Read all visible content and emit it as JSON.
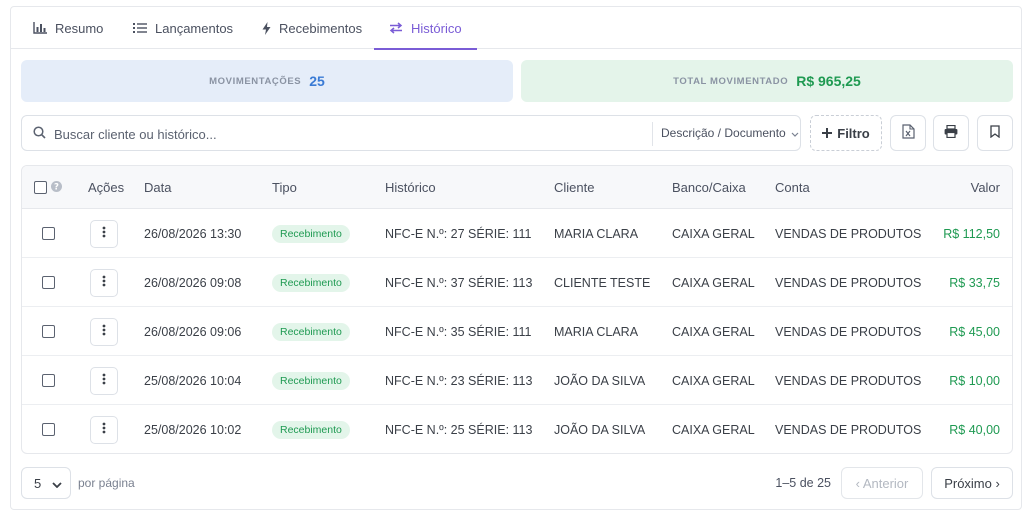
{
  "tabs": [
    {
      "label": "Resumo",
      "icon": "bar-chart-icon"
    },
    {
      "label": "Lançamentos",
      "icon": "list-icon"
    },
    {
      "label": "Recebimentos",
      "icon": "bolt-icon"
    },
    {
      "label": "Histórico",
      "icon": "swap-arrows-icon",
      "active": true
    }
  ],
  "stats": {
    "movimentacoes_label": "MOVIMENTAÇÕES",
    "movimentacoes_value": "25",
    "total_label": "TOTAL MOVIMENTADO",
    "total_value": "R$ 965,25"
  },
  "toolbar": {
    "search_placeholder": "Buscar cliente ou histórico...",
    "search_value": "",
    "filter_field": "Descrição / Documento",
    "filter_button": "Filtro"
  },
  "table": {
    "headers": [
      "Ações",
      "Data",
      "Tipo",
      "Histórico",
      "Cliente",
      "Banco/Caixa",
      "Conta",
      "Valor"
    ],
    "rows": [
      {
        "data": "26/08/2026 13:30",
        "tipo": "Recebimento",
        "historico": "NFC-E N.º: 27 SÉRIE: 111",
        "cliente": "MARIA CLARA",
        "banco": "CAIXA GERAL",
        "conta": "VENDAS DE PRODUTOS",
        "valor": "R$ 112,50"
      },
      {
        "data": "26/08/2026 09:08",
        "tipo": "Recebimento",
        "historico": "NFC-E N.º: 37 SÉRIE: 113",
        "cliente": "CLIENTE TESTE",
        "banco": "CAIXA GERAL",
        "conta": "VENDAS DE PRODUTOS",
        "valor": "R$ 33,75"
      },
      {
        "data": "26/08/2026 09:06",
        "tipo": "Recebimento",
        "historico": "NFC-E N.º: 35 SÉRIE: 111",
        "cliente": "MARIA CLARA",
        "banco": "CAIXA GERAL",
        "conta": "VENDAS DE PRODUTOS",
        "valor": "R$ 45,00"
      },
      {
        "data": "25/08/2026 10:04",
        "tipo": "Recebimento",
        "historico": "NFC-E N.º: 23 SÉRIE: 113",
        "cliente": "JOÃO DA SILVA",
        "banco": "CAIXA GERAL",
        "conta": "VENDAS DE PRODUTOS",
        "valor": "R$ 10,00"
      },
      {
        "data": "25/08/2026 10:02",
        "tipo": "Recebimento",
        "historico": "NFC-E N.º: 25 SÉRIE: 113",
        "cliente": "JOÃO DA SILVA",
        "banco": "CAIXA GERAL",
        "conta": "VENDAS DE PRODUTOS",
        "valor": "R$ 40,00"
      }
    ]
  },
  "pagination": {
    "per_page": "5",
    "per_page_label": "por página",
    "range": "1–5 de 25",
    "prev": "‹ Anterior",
    "next": "Próximo ›"
  },
  "colors": {
    "accent": "#7a5cd6",
    "money": "#1f9a52",
    "count": "#3a7bd5"
  }
}
